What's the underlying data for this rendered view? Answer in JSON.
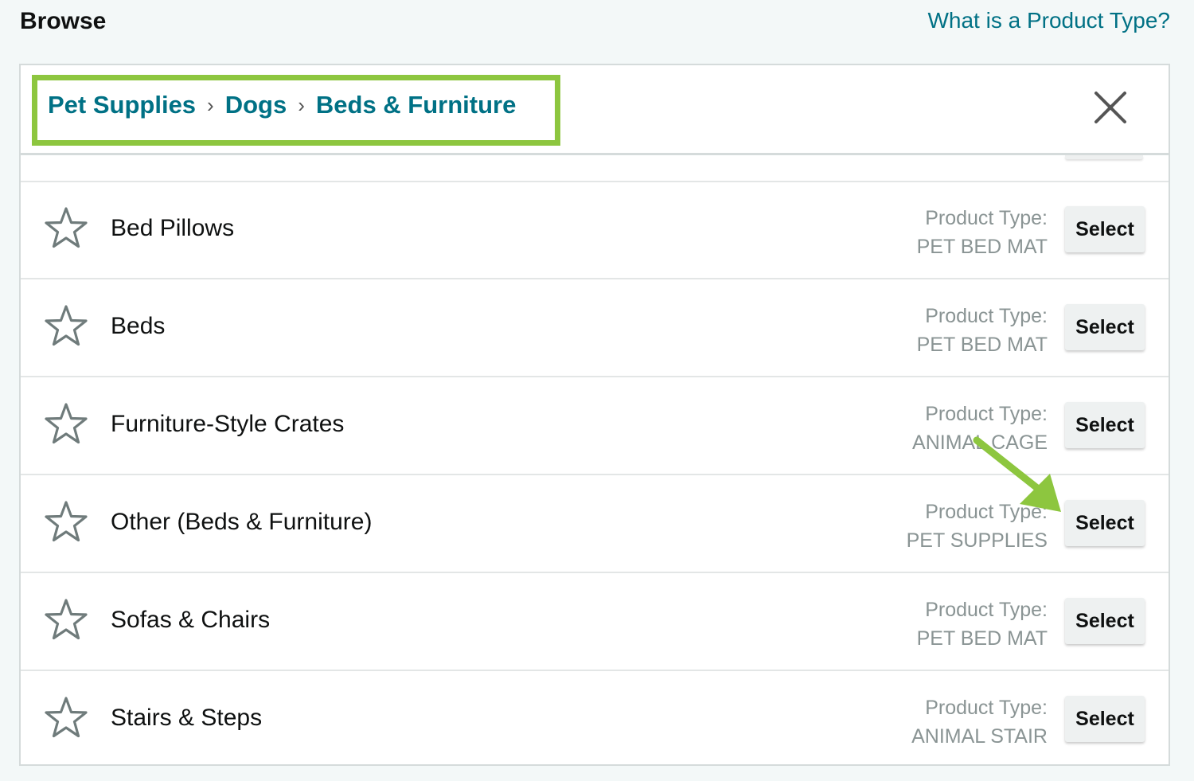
{
  "header": {
    "title": "Browse",
    "help_link": "What is a Product Type?"
  },
  "breadcrumb": {
    "items": [
      "Pet Supplies",
      "Dogs",
      "Beds & Furniture"
    ],
    "separator": "›"
  },
  "colors": {
    "link": "#007185",
    "highlight": "#8dc63f",
    "muted_text": "#8a9494",
    "button_bg": "#eef1f1"
  },
  "icons": {
    "close": "close-icon",
    "favorite": "star-outline-icon",
    "annotation": "green-arrow-icon"
  },
  "rows": [
    {
      "label": "Bed Pillows",
      "type_label": "Product Type:",
      "type_value": "PET BED MAT",
      "button": "Select"
    },
    {
      "label": "Beds",
      "type_label": "Product Type:",
      "type_value": "PET BED MAT",
      "button": "Select"
    },
    {
      "label": "Furniture-Style Crates",
      "type_label": "Product Type:",
      "type_value": "ANIMAL CAGE",
      "button": "Select"
    },
    {
      "label": "Other (Beds & Furniture)",
      "type_label": "Product Type:",
      "type_value": "PET SUPPLIES",
      "button": "Select"
    },
    {
      "label": "Sofas & Chairs",
      "type_label": "Product Type:",
      "type_value": "PET BED MAT",
      "button": "Select"
    },
    {
      "label": "Stairs & Steps",
      "type_label": "Product Type:",
      "type_value": "ANIMAL STAIR",
      "button": "Select"
    }
  ]
}
